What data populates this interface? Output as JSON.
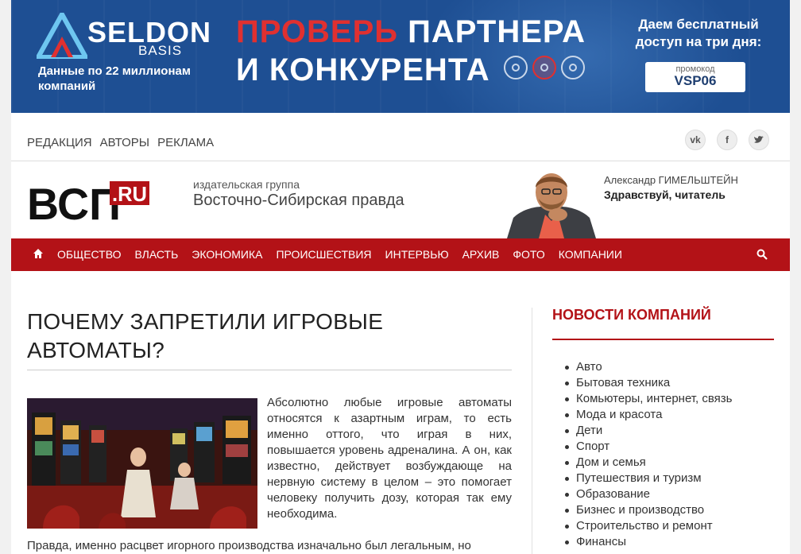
{
  "banner": {
    "brand": "SELDON",
    "brand_sub": "BASIS",
    "tagline": "Данные по 22 миллионам компаний",
    "headline_red": "ПРОВЕРЬ",
    "headline_rest": " ПАРТНЕРА",
    "headline_line2": "И КОНКУРЕНТА",
    "offer": "Даем бесплатный доступ на три дня:",
    "promo_label": "промокод",
    "promo_code": "VSP06",
    "colors": {
      "background": "#1e4f93",
      "accent": "#e03030"
    }
  },
  "top_links": [
    "РЕДАКЦИЯ",
    "АВТОРЫ",
    "РЕКЛАМА"
  ],
  "socials": [
    {
      "icon": "vk-icon",
      "glyph": "vk"
    },
    {
      "icon": "facebook-icon",
      "glyph": "f"
    },
    {
      "icon": "twitter-icon",
      "glyph": "t"
    }
  ],
  "header": {
    "logo_text": "ВСП",
    "logo_ru": ".RU",
    "publisher_small": "издательская группа",
    "publisher_big": "Восточно-Сибирская правда",
    "author_name": "Александр ГИМЕЛЬШТЕЙН",
    "author_greeting": "Здравствуй, читатель"
  },
  "nav": {
    "home_icon": "home-icon",
    "search_icon": "search-icon",
    "items": [
      "ОБЩЕСТВО",
      "ВЛАСТЬ",
      "ЭКОНОМИКА",
      "ПРОИСШЕСТВИЯ",
      "ИНТЕРВЬЮ",
      "АРХИВ",
      "ФОТО",
      "КОМПАНИИ"
    ],
    "color": "#b31217"
  },
  "article": {
    "title": "ПОЧЕМУ ЗАПРЕТИЛИ ИГРОВЫЕ АВТОМАТЫ?",
    "paragraph1": "Абсолютно любые игровые автоматы относятся к азартным играм, то есть именно оттого, что играя в них, повышается уровень адреналина. А он, как известно, действует возбуждающе на нервную систему в целом – это помогает человеку получить дозу, которая так ему необходима.",
    "paragraph2": "Правда, именно расцвет игорного производства изначально был легальным, но"
  },
  "sidebar": {
    "title": "НОВОСТИ КОМПАНИЙ",
    "categories": [
      "Авто",
      "Бытовая техника",
      "Комьютеры, интернет, связь",
      "Мода и красота",
      "Дети",
      "Спорт",
      "Дом и семья",
      "Путешествия и туризм",
      "Образование",
      "Бизнес и производство",
      "Строительство и ремонт",
      "Финансы"
    ]
  }
}
